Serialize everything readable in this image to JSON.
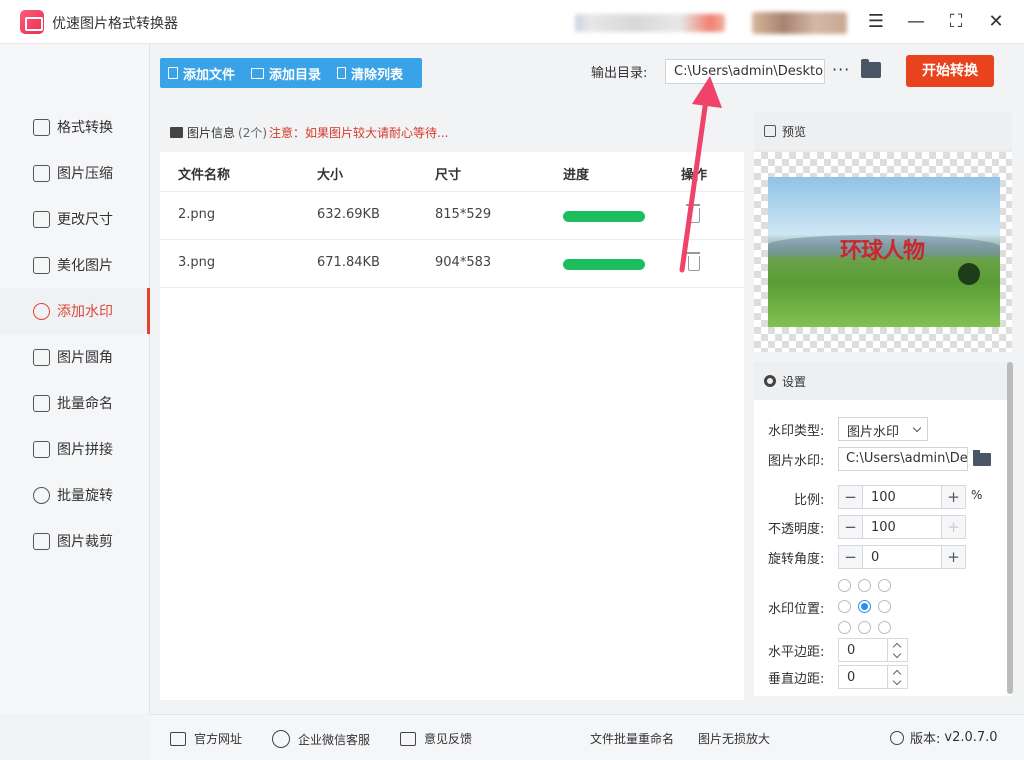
{
  "app": {
    "title": "优速图片格式转换器"
  },
  "window": {
    "menu_icon": "hamburger-icon",
    "minimize_icon": "minimize-icon",
    "maximize_icon": "maximize-icon",
    "close_icon": "close-icon"
  },
  "sidebar": {
    "items": [
      {
        "label": "格式转换",
        "icon": "format-convert-icon"
      },
      {
        "label": "图片压缩",
        "icon": "compress-icon"
      },
      {
        "label": "更改尺寸",
        "icon": "resize-icon"
      },
      {
        "label": "美化图片",
        "icon": "beautify-icon"
      },
      {
        "label": "添加水印",
        "icon": "watermark-icon",
        "active": true
      },
      {
        "label": "图片圆角",
        "icon": "rounded-corner-icon"
      },
      {
        "label": "批量命名",
        "icon": "rename-icon"
      },
      {
        "label": "图片拼接",
        "icon": "stitch-icon"
      },
      {
        "label": "批量旋转",
        "icon": "rotate-icon"
      },
      {
        "label": "图片裁剪",
        "icon": "crop-icon"
      }
    ]
  },
  "toolbar": {
    "add_file": "添加文件",
    "add_folder": "添加目录",
    "clear_list": "清除列表",
    "output_label": "输出目录:",
    "output_path": "C:\\Users\\admin\\Deskto",
    "more": "···",
    "start": "开始转换"
  },
  "file_list": {
    "header_title": "图片信息",
    "header_count": "(2个)",
    "header_warning": "注意：如果图片较大请耐心等待...",
    "columns": [
      "文件名称",
      "大小",
      "尺寸",
      "进度",
      "操作"
    ],
    "rows": [
      {
        "name": "2.png",
        "size": "632.69KB",
        "dims": "815*529",
        "progress": 100
      },
      {
        "name": "3.png",
        "size": "671.84KB",
        "dims": "904*583",
        "progress": 100
      }
    ]
  },
  "preview": {
    "title": "预览",
    "watermark_text": "环球人物"
  },
  "settings": {
    "title": "设置",
    "type_label": "水印类型:",
    "type_value": "图片水印",
    "image_label": "图片水印:",
    "image_path": "C:\\Users\\admin\\De",
    "scale_label": "比例:",
    "scale_value": "100",
    "scale_unit": "%",
    "opacity_label": "不透明度:",
    "opacity_value": "100",
    "rotation_label": "旋转角度:",
    "rotation_value": "0",
    "position_label": "水印位置:",
    "position_selected": "center",
    "h_margin_label": "水平边距:",
    "h_margin_value": "0",
    "v_margin_label": "垂直边距:",
    "v_margin_value": "0"
  },
  "footer": {
    "website": "官方网址",
    "wechat": "企业微信客服",
    "feedback": "意见反馈",
    "batch_rename": "文件批量重命名",
    "lossless": "图片无损放大",
    "version_label": "版本:",
    "version": "v2.0.7.0"
  },
  "colors": {
    "accent": "#3aa3e8",
    "start": "#e9431e",
    "progress": "#1cbe5e",
    "active_nav": "#e0462f"
  }
}
